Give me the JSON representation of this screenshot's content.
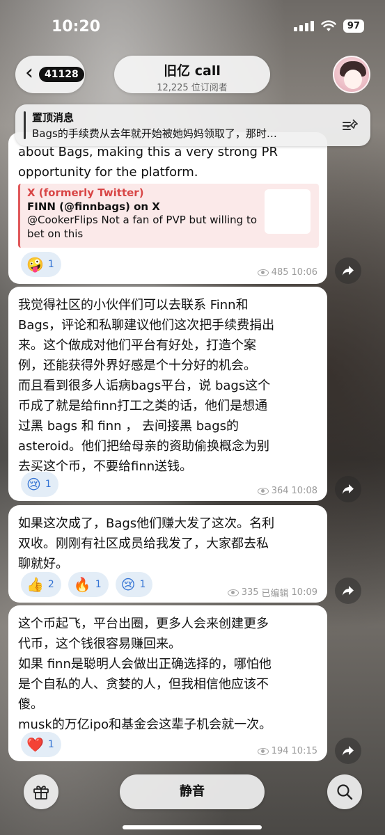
{
  "status_bar": {
    "time": "10:20",
    "battery": "97"
  },
  "header": {
    "back_count": "41128",
    "channel_title": "旧亿 call",
    "subscribers": "12,225 位订阅者"
  },
  "pinned": {
    "label": "置顶消息",
    "text": "Bags的手续费从去年就开始被她妈妈领取了，那时…"
  },
  "messages": [
    {
      "body": "about Bags, making this a very strong PR\nopportunity for the platform.",
      "link": {
        "source": "X (formerly Twitter)",
        "title": "FINN (@finnbags) on X",
        "description": "@CookerFlips Not a fan of PVP but willing to bet on this"
      },
      "reactions": [
        {
          "emoji": "🤪",
          "count": "1"
        }
      ],
      "views": "485",
      "time": "10:06"
    },
    {
      "body": "我觉得社区的小伙伴们可以去联系 Finn和\nBags，评论和私聊建议他们这次把手续费捐出\n来。这个做成对他们平台有好处，打造个案\n例，还能获得外界好感是个十分好的机会。\n而且看到很多人诟病bags平台，说 bags这个\n币成了就是给finn打工之类的话，他们是想通\n过黑 bags 和 finn ， 去间接黑 bags的\nasteroid。他们把给母亲的资助偷换概念为别\n去买这个币，不要给finn送钱。",
      "reactions": [
        {
          "emoji": "😢",
          "count": "1"
        }
      ],
      "views": "364",
      "time": "10:08"
    },
    {
      "body": "如果这次成了，Bags他们赚大发了这次。名利\n双收。刚刚有社区成员给我发了，大家都去私\n聊就好。",
      "reactions": [
        {
          "emoji": "👍",
          "count": "2"
        },
        {
          "emoji": "🔥",
          "count": "1"
        },
        {
          "emoji": "😢",
          "count": "1"
        }
      ],
      "views": "335",
      "edited": "已编辑",
      "time": "10:09"
    },
    {
      "body": "这个币起飞，平台出圈，更多人会来创建更多\n代币，这个钱很容易赚回来。\n如果 finn是聪明人会做出正确选择的，哪怕他\n是个自私的人、贪婪的人，但我相信他应该不\n傻。\nmusk的万亿ipo和基金会这辈子机会就一次。",
      "reactions": [
        {
          "emoji": "❤️",
          "count": "1"
        }
      ],
      "views": "194",
      "time": "10:15"
    }
  ],
  "bottom": {
    "mute_label": "静音"
  }
}
